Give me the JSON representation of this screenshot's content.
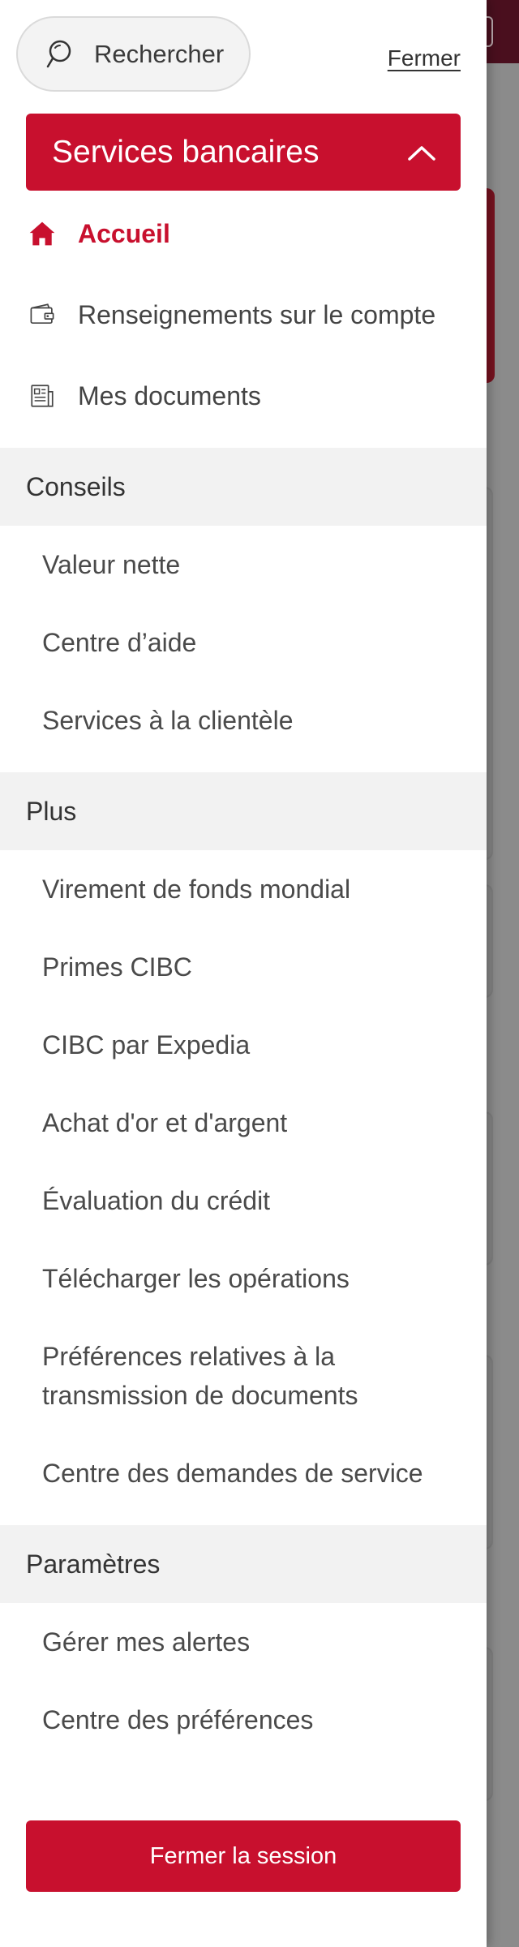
{
  "colors": {
    "accent": "#c8102e",
    "text": "#444444",
    "section_bg": "#f2f2f2",
    "search_bg": "#f3f3f3"
  },
  "search": {
    "label": "Rechercher",
    "icon": "search-icon"
  },
  "close_label": "Fermer",
  "banking": {
    "title": "Services bancaires",
    "expanded": true,
    "icon": "chevron-up-icon",
    "items": [
      {
        "label": "Accueil",
        "icon": "home-icon",
        "active": true
      },
      {
        "label": "Renseignements sur le compte",
        "icon": "wallet-icon",
        "active": false
      },
      {
        "label": "Mes documents",
        "icon": "document-icon",
        "active": false
      }
    ]
  },
  "sections": {
    "conseils": {
      "title": "Conseils",
      "items": [
        "Valeur nette",
        "Centre d’aide",
        "Services à la clientèle"
      ]
    },
    "plus": {
      "title": "Plus",
      "items": [
        "Virement de fonds mondial",
        "Primes CIBC",
        "CIBC par Expedia",
        "Achat d'or et d'argent",
        "Évaluation du crédit",
        "Télécharger les opérations",
        "Préférences relatives à la transmission de documents",
        "Centre des demandes de service"
      ]
    },
    "parametres": {
      "title": "Paramètres",
      "items": [
        "Gérer mes alertes",
        "Centre des préférences"
      ]
    }
  },
  "logout_label": "Fermer la session"
}
